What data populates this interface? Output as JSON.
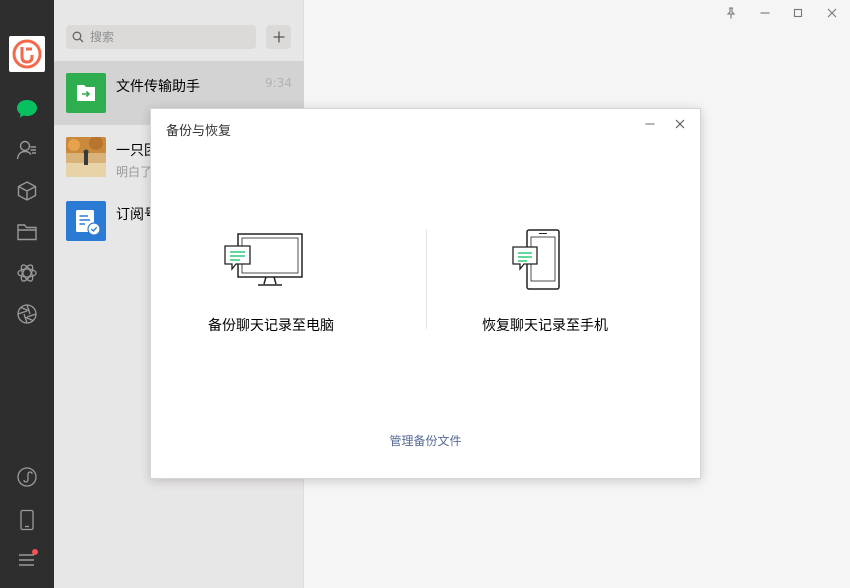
{
  "search": {
    "placeholder": "搜索"
  },
  "chats": [
    {
      "name": "文件传输助手",
      "preview": "",
      "time": "9:34"
    },
    {
      "name": "一只团",
      "preview": "明白了",
      "time": ""
    },
    {
      "name": "订阅号",
      "preview": "",
      "time": ""
    }
  ],
  "dialog": {
    "title": "备份与恢复",
    "backup_label": "备份聊天记录至电脑",
    "restore_label": "恢复聊天记录至手机",
    "manage_link": "管理备份文件"
  },
  "colors": {
    "rail_bg": "#2e2e2e",
    "accent_green": "#07c160",
    "link_blue": "#576b95",
    "notification_red": "#fa5151"
  },
  "icons": {
    "rail": [
      "chat-icon",
      "contacts-icon",
      "favorites-icon",
      "files-icon",
      "moments-icon",
      "miniprogram-icon",
      "mobile-icon",
      "menu-icon"
    ],
    "window": [
      "pin-icon",
      "minimize-icon",
      "maximize-icon",
      "close-icon"
    ]
  }
}
